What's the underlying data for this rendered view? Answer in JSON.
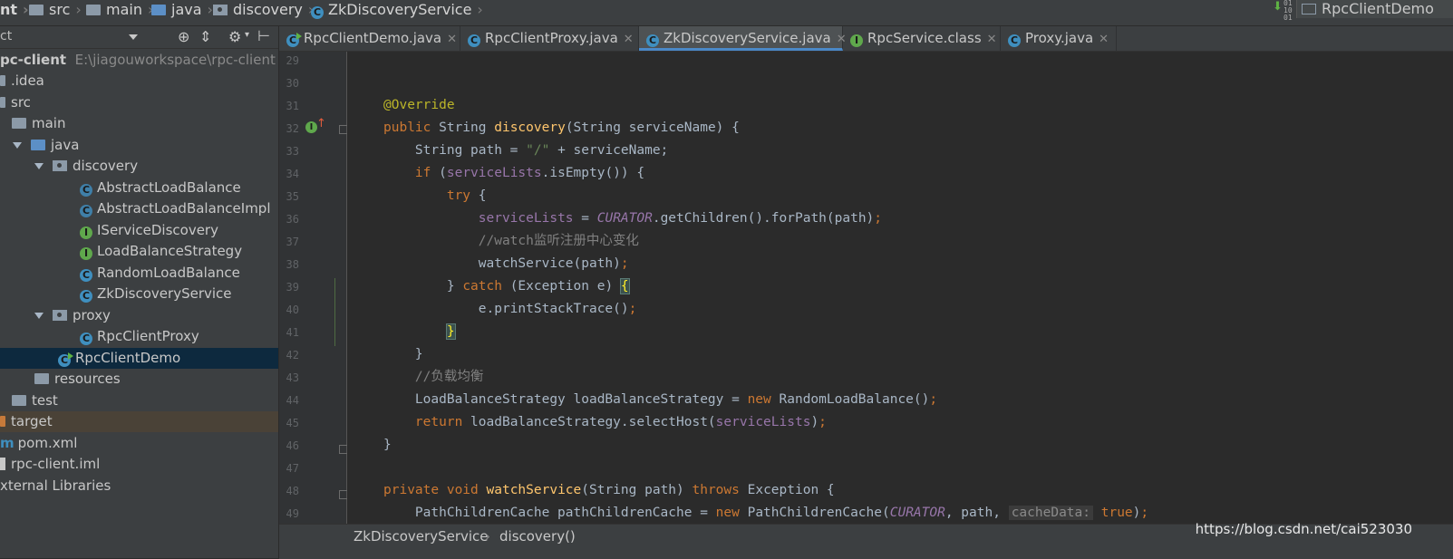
{
  "breadcrumb": {
    "items": [
      "nt",
      "src",
      "main",
      "java",
      "discovery",
      "ZkDiscoveryService"
    ],
    "right_label": "RpcClientDemo"
  },
  "sidebar": {
    "view_label": "ct",
    "tree": [
      {
        "label": "pc-client",
        "path": "E:\\jiagouworkspace\\rpc-client"
      },
      {
        "label": ".idea"
      },
      {
        "label": "src"
      },
      {
        "label": "main"
      },
      {
        "label": "java"
      },
      {
        "label": "discovery"
      },
      {
        "label": "AbstractLoadBalance"
      },
      {
        "label": "AbstractLoadBalanceImpl"
      },
      {
        "label": "IServiceDiscovery"
      },
      {
        "label": "LoadBalanceStrategy"
      },
      {
        "label": "RandomLoadBalance"
      },
      {
        "label": "ZkDiscoveryService"
      },
      {
        "label": "proxy"
      },
      {
        "label": "RpcClientProxy"
      },
      {
        "label": "RpcClientDemo"
      },
      {
        "label": "resources"
      },
      {
        "label": "test"
      },
      {
        "label": "target"
      },
      {
        "label": "pom.xml"
      },
      {
        "label": "rpc-client.iml"
      },
      {
        "label": "xternal Libraries"
      }
    ]
  },
  "tabs": [
    {
      "label": "RpcClientDemo.java"
    },
    {
      "label": "RpcClientProxy.java"
    },
    {
      "label": "ZkDiscoveryService.java"
    },
    {
      "label": "RpcService.class"
    },
    {
      "label": "Proxy.java"
    }
  ],
  "editor": {
    "line_numbers": [
      "29",
      "30",
      "31",
      "32",
      "33",
      "34",
      "35",
      "36",
      "37",
      "38",
      "39",
      "40",
      "41",
      "42",
      "43",
      "44",
      "45",
      "46",
      "47",
      "48",
      "49"
    ]
  },
  "status": {
    "class_name": "ZkDiscoveryService",
    "method_name": "discovery()"
  },
  "watermark": "https://blog.csdn.net/cai523030",
  "colors": {
    "background": "#2b2b2b",
    "panel": "#3c3f41",
    "keyword": "#cc7832",
    "function": "#ffc66d",
    "field": "#9876aa",
    "annotation": "#bbb529",
    "string": "#6a8759",
    "comment": "#808080"
  }
}
